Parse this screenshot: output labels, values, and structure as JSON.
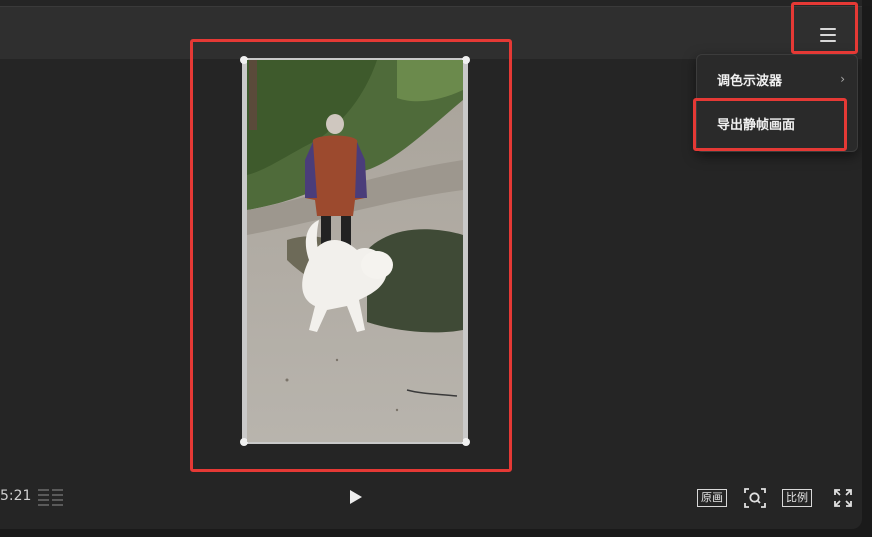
{
  "menu": {
    "items": [
      {
        "label": "调色示波器",
        "has_submenu": true
      },
      {
        "label": "导出静帧画面",
        "has_submenu": false
      }
    ]
  },
  "player": {
    "timecode": "5:21",
    "buttons": {
      "original": "原画",
      "ratio": "比例"
    }
  },
  "colors": {
    "highlight": "#e53935",
    "background": "#252525",
    "topbar": "#2f2f2f"
  }
}
